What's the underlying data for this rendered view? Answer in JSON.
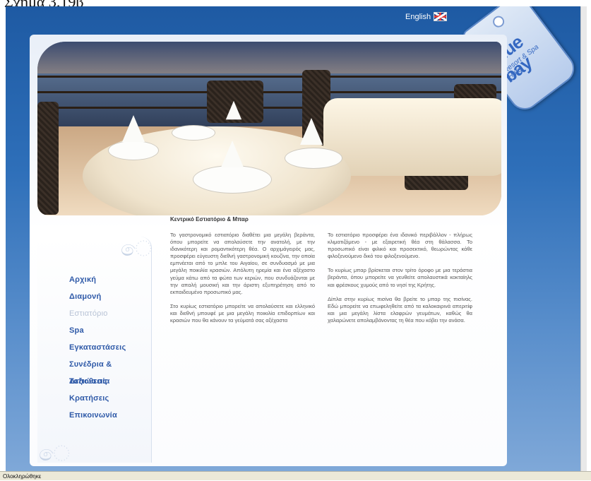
{
  "figure_caption": "Σχήμα 3.19β",
  "header": {
    "language_label": "English"
  },
  "logo": {
    "brand": "blue bay",
    "tagline": "Resort & Spa Hotel"
  },
  "nav": {
    "items": [
      {
        "label": "Αρχική"
      },
      {
        "label": "Διαμονή"
      },
      {
        "label": "Εστιατόριο"
      },
      {
        "label": "Spa"
      },
      {
        "label": "Εγκαταστάσεις"
      },
      {
        "label": "Συνέδρια & Δεξιώσεις"
      },
      {
        "label": "Τοποθεσία"
      },
      {
        "label": "Κρατήσεις"
      },
      {
        "label": "Επικοινωνία"
      }
    ],
    "active_index": 2
  },
  "content": {
    "title": "Κεντρικό Εστιατόριο & Μπαρ",
    "left_paragraphs": [
      "Το γαστρονομικό εστιατόριο διαθέτει μια μεγάλη βεράντα, όπου μπορείτε να απολαύσετε την ανατολή, με την ιδανικότερη και ρομαντικότερη θέα. Ο αρχιμάγειρός μας, προσφέρει εύγευστη διεθνή γαστρονομική κουζίνα, την οποία εμπνέεται από το μπλε του Αιγαίου, σε συνδυασμό με μια μεγάλη ποικιλία κρασιών. Απόλυτη ηρεμία και ένα αξέχαστο γεύμα κάτω από τα φώτα των κεριών, που συνδυάζονται με την απαλή μουσική και την άριστη εξυπηρέτηση από το εκπαιδευμένο προσωπικό μας.",
      "Στο κυρίως εστιατόριο μπορείτε να απολαύσετε και ελληνικό και διεθνή μπουφέ με μια μεγάλη ποικιλία επιδορπίων και κρασιών που θα κάνουν τα γεύματά σας αξέχαστα"
    ],
    "right_paragraphs": [
      "Το εστιατόριο προσφέρει ένα ιδανικό περιβάλλον - πλήρως κλιματιζόμενο - με εξαιρετική θέα στη θάλασσα. Το προσωπικό είναι φιλικό και προσεκτικό, θεωρώντας κάθε φιλοξενούμενο δικό του φιλοξενούμενο.",
      "Το κυρίως μπαρ βρίσκεται στον τρίτο όροφο με μια τεράστια βεράντα, όπου μπορείτε να γευθείτε απολαυστικά κοκταίηλς και φρέσκους χυμούς από το νησί της Κρήτης.",
      "Δίπλα στην κυρίως πισίνα θα βρείτε το μπαρ της πισίνας. Εδώ μπορείτε να επωφεληθείτε από τα καλοκαιρινά απεριτίφ και μια μεγάλη λίστα ελαφρών γευμάτων, καθώς θα χαλαρώνετε απολαμβάνοντας τη θέα που κόβει την ανάσα."
    ]
  },
  "statusbar": {
    "text": "Ολοκληρώθηκε"
  }
}
